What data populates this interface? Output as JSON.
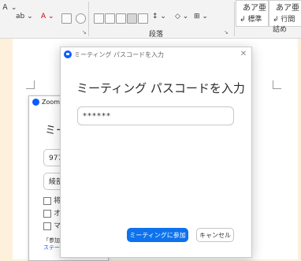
{
  "ribbon": {
    "paragraph_group_label": "段落",
    "styles": [
      {
        "preview": "あア亜",
        "name": "標準"
      },
      {
        "preview": "あア亜",
        "name": "行間詰め"
      }
    ]
  },
  "background_zoom": {
    "title": "Zoom",
    "heading_fragment": "ミー",
    "field1_value": "977",
    "field2_value": "綾部",
    "checks": [
      "将",
      "オ",
      "マ"
    ],
    "footer_fragment": "「参加」",
    "link_fragment": "ステー"
  },
  "dialog": {
    "title": "ミーティング パスコードを入力",
    "heading": "ミーティング パスコードを入力",
    "passcode_value": "******",
    "join_label": "ミーティングに参加",
    "cancel_label": "キャンセル",
    "accent_color": "#0e72ed"
  }
}
